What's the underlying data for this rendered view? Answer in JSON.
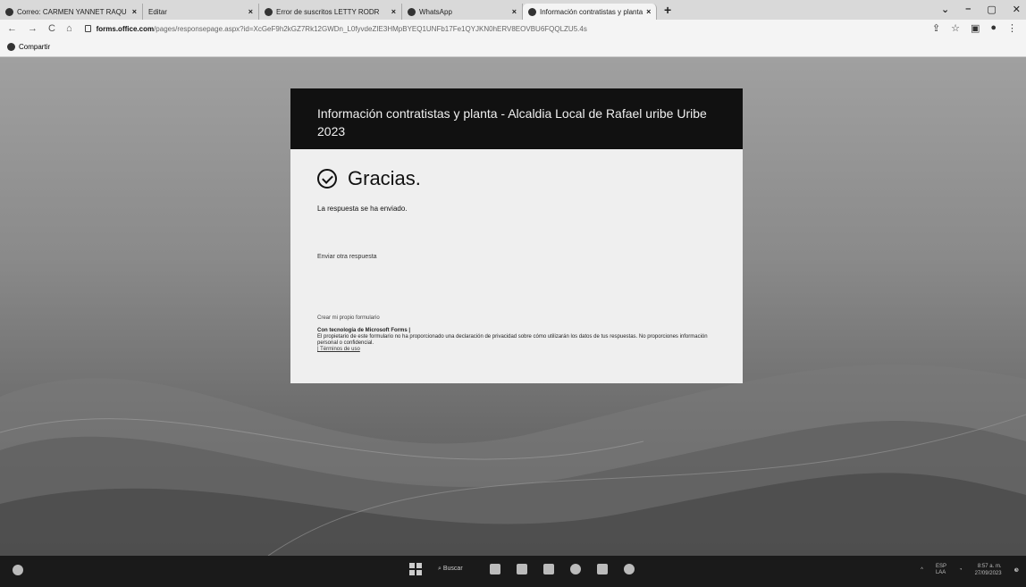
{
  "browser": {
    "tabs": [
      {
        "title": "Correo: CARMEN YANNET RAQU"
      },
      {
        "title": "Editar"
      },
      {
        "title": "Error de suscritos LETTY RODR"
      },
      {
        "title": "WhatsApp"
      },
      {
        "title": "Información contratistas y planta"
      }
    ],
    "new_tab": "+",
    "window_controls": {
      "minimize": "–",
      "maximize": "▢",
      "close": "✕"
    },
    "nav": {
      "back": "←",
      "forward": "→",
      "reload": "C",
      "home": "⌂"
    },
    "url_domain": "forms.office.com",
    "url_path": "/pages/responsepage.aspx?id=XcGeF9h2kGZ7Rk12GWDn_L0fyvdeZIE3HMpBYEQ1UNFb17Fe1QYJKN0hERV8EOVBU6FQQLZU5.4s",
    "bookmark": "Compartir",
    "right_icons": {
      "share": "⇪",
      "star": "☆",
      "sidebar": "▣",
      "profile": "●",
      "menu": "⋮"
    }
  },
  "form": {
    "title": "Información contratistas y planta - Alcaldia Local de Rafael uribe Uribe 2023",
    "thanks": "Gracias.",
    "sent_message": "La respuesta se ha enviado.",
    "another_response": "Enviar otra respuesta",
    "create_own": "Crear mi propio formulario",
    "powered_by": "Con tecnología de Microsoft Forms |",
    "privacy_note": "El propietario de este formulario no ha proporcionado una declaración de privacidad sobre cómo utilizarán los datos de tus respuestas. No proporciones información personal o confidencial.",
    "terms": "| Términos de uso"
  },
  "taskbar": {
    "search": "Buscar",
    "lang": "ESP\nLAA",
    "time": "8:57 a. m.",
    "date": "27/09/2023"
  }
}
